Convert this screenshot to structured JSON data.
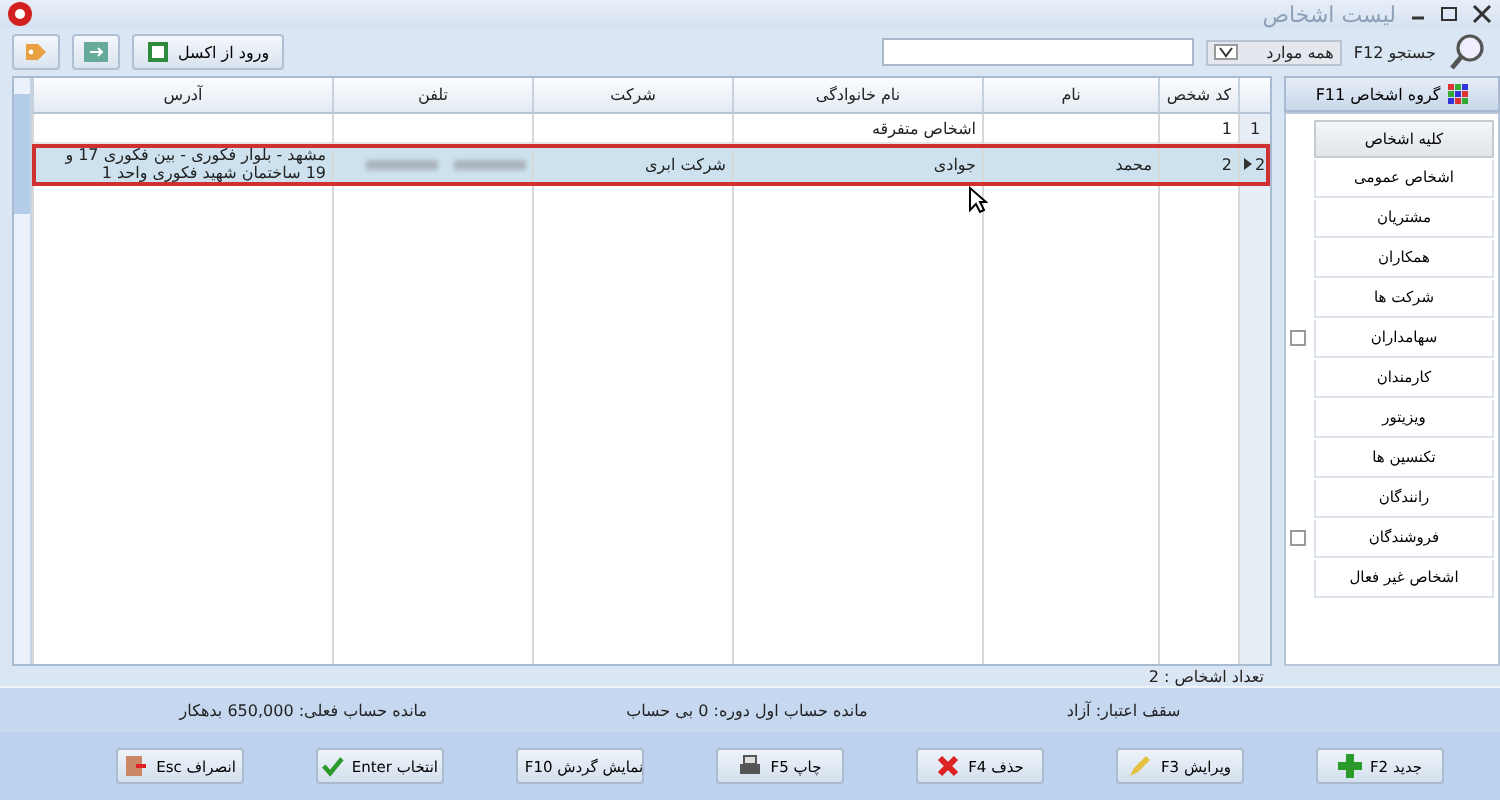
{
  "window": {
    "title": "لیست اشخاص"
  },
  "toolbar": {
    "search_label": "جستجو F12",
    "filter": "همه موارد",
    "import_button": "ورود از اکسل"
  },
  "sidebar": {
    "header": "گروه اشخاص F11",
    "items": [
      {
        "label": "کلیه اشخاص",
        "selected": true,
        "expandable": false
      },
      {
        "label": "اشخاص عمومی",
        "selected": false,
        "expandable": false
      },
      {
        "label": "مشتریان",
        "selected": false,
        "expandable": false
      },
      {
        "label": "همکاران",
        "selected": false,
        "expandable": false
      },
      {
        "label": "شرکت ها",
        "selected": false,
        "expandable": false
      },
      {
        "label": "سهامداران",
        "selected": false,
        "expandable": true
      },
      {
        "label": "کارمندان",
        "selected": false,
        "expandable": false
      },
      {
        "label": "ویزیتور",
        "selected": false,
        "expandable": false
      },
      {
        "label": "تکنسین ها",
        "selected": false,
        "expandable": false
      },
      {
        "label": "رانندگان",
        "selected": false,
        "expandable": false
      },
      {
        "label": "فروشندگان",
        "selected": false,
        "expandable": true
      },
      {
        "label": "اشخاص غیر فعال",
        "selected": false,
        "expandable": false
      }
    ]
  },
  "table": {
    "columns": [
      "کد شخص",
      "نام",
      "نام خانوادگی",
      "شرکت",
      "تلفن",
      "آدرس"
    ],
    "rows": [
      {
        "number": "1",
        "selected": false,
        "cells": [
          "1",
          "",
          "اشخاص متفرقه",
          "",
          "",
          ""
        ],
        "phone_blurred": false
      },
      {
        "number": "2",
        "selected": true,
        "cells": [
          "2",
          "محمد",
          "جوادی",
          "شرکت ابری",
          "",
          "مشهد - بلوار فکوری - بین فکوری 17 و 19 ساختمان شهید فکوری واحد 1"
        ],
        "phone_blurred": true
      }
    ]
  },
  "count": "تعداد اشخاص : 2",
  "status": [
    "سقف اعتبار: آزاد",
    "مانده حساب اول دوره: 0 بی حساب",
    "مانده حساب فعلی: 650,000 بدهکار"
  ],
  "buttons": [
    {
      "label": "جدید F2",
      "kind": "add"
    },
    {
      "label": "ویرایش F3",
      "kind": "edit"
    },
    {
      "label": "حذف F4",
      "kind": "delete"
    },
    {
      "label": "چاپ F5",
      "kind": "print"
    },
    {
      "label": "نمایش گردش F10",
      "kind": "history"
    },
    {
      "label": "انتخاب Enter",
      "kind": "select"
    },
    {
      "label": "انصراف Esc",
      "kind": "cancel"
    }
  ]
}
